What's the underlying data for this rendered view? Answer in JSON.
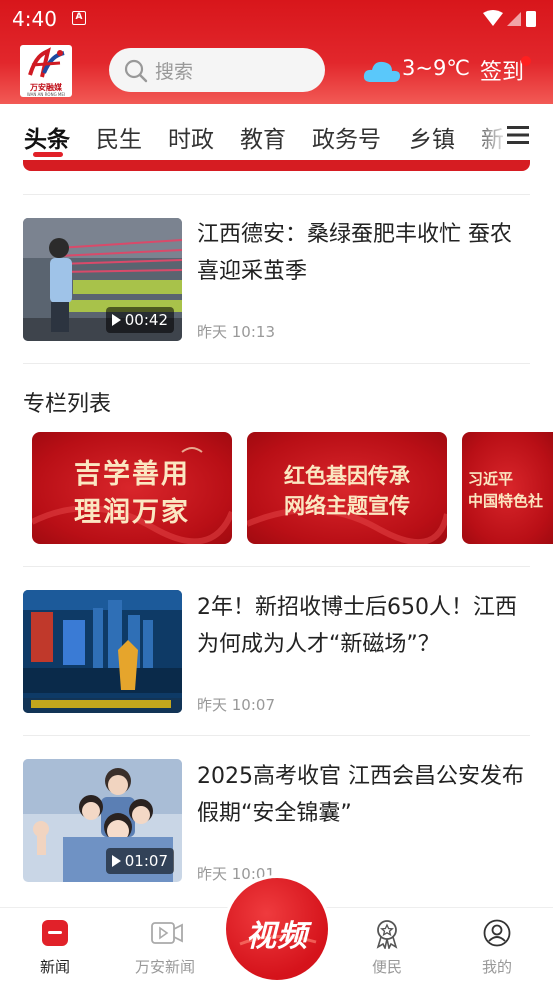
{
  "status_bar": {
    "time": "4:40",
    "notification_icon": "A"
  },
  "header": {
    "logo_text": "万安融媒",
    "logo_subtext": "WAN AN RONG MEI",
    "search_placeholder": "搜索",
    "weather_icon": "cloud-icon",
    "temperature": "3~9℃",
    "signin_label": "签到"
  },
  "tabs": [
    "头条",
    "民生",
    "时政",
    "教育",
    "政务号",
    "乡镇",
    "新"
  ],
  "active_tab": "头条",
  "news_items": [
    {
      "title": "江西德安：桑绿蚕肥丰收忙 蚕农喜迎采茧季",
      "time": "昨天 10:13",
      "duration": "00:42"
    },
    {
      "title": "2年！新招收博士后650人！江西为何成为人才“新磁场”？",
      "time": "昨天 10:07"
    },
    {
      "title": "2025高考收官 江西会昌公安发布假期“安全锦囊”",
      "time": "昨天 10:01",
      "duration": "01:07"
    }
  ],
  "columns_section": {
    "title": "专栏列表",
    "cards": [
      {
        "line1": "吉学善用",
        "line2": "理润万家"
      },
      {
        "line1": "红色基因传承",
        "line2": "网络主题宣传"
      },
      {
        "line1": "习近平",
        "line2": "中国特色社"
      }
    ]
  },
  "bottom_nav": {
    "items": [
      {
        "label": "新闻",
        "icon": "news-icon",
        "active": true
      },
      {
        "label": "万安新闻",
        "icon": "video-play-icon",
        "active": false
      },
      {
        "label": "便民",
        "icon": "ribbon-badge-icon",
        "active": false
      },
      {
        "label": "我的",
        "icon": "profile-icon",
        "active": false
      }
    ],
    "center_button_label": "视频"
  },
  "colors": {
    "brand_red": "#e12129",
    "accent_gold": "#fbe7c2"
  }
}
